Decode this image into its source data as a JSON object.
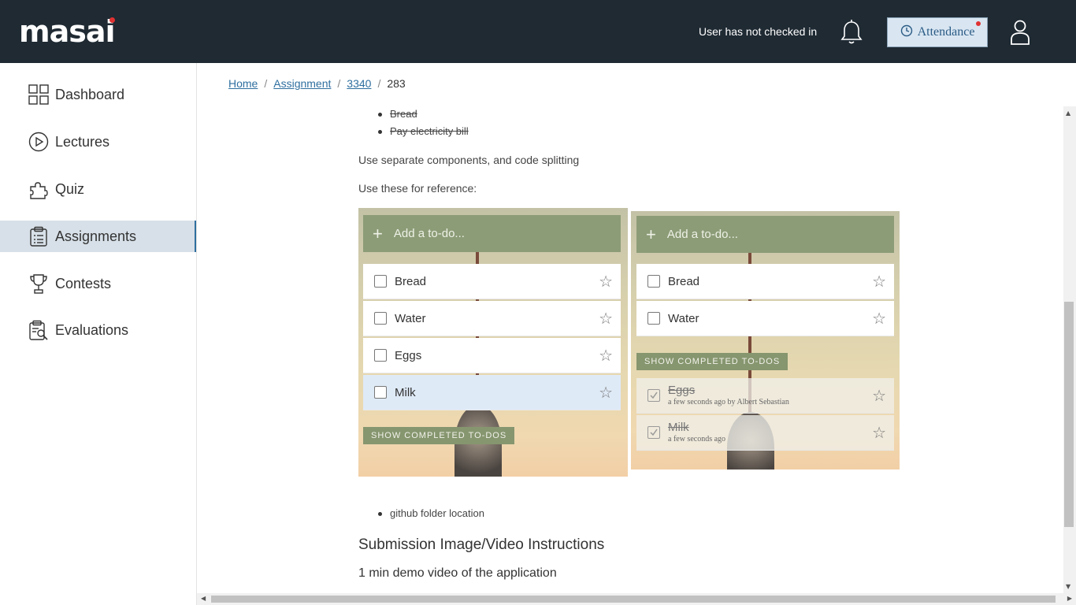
{
  "brand": {
    "name": "masai"
  },
  "header": {
    "checkin_status": "User has not checked in",
    "attendance_label": "Attendance"
  },
  "sidebar": {
    "items": [
      {
        "label": "Dashboard",
        "icon": "dashboard-icon",
        "active": false
      },
      {
        "label": "Lectures",
        "icon": "play-circle-icon",
        "active": false
      },
      {
        "label": "Quiz",
        "icon": "puzzle-icon",
        "active": false
      },
      {
        "label": "Assignments",
        "icon": "clipboard-icon",
        "active": true
      },
      {
        "label": "Contests",
        "icon": "trophy-icon",
        "active": false
      },
      {
        "label": "Evaluations",
        "icon": "evaluation-icon",
        "active": false
      }
    ]
  },
  "breadcrumb": {
    "items": [
      "Home",
      "Assignment",
      "3340"
    ],
    "current": "283",
    "separator": "/"
  },
  "content": {
    "done_bullets": [
      "Bread",
      "Pay electricity bill"
    ],
    "para1": "Use separate components, and code splitting",
    "para2": "Use these for reference:",
    "bullet_github": "github folder location",
    "heading": "Submission Image/Video Instructions",
    "subheading": "1 min demo video of the application"
  },
  "ref_left": {
    "placeholder": "Add a to-do...",
    "todos": [
      "Bread",
      "Water",
      "Eggs",
      "Milk"
    ],
    "show_completed": "SHOW COMPLETED TO-DOS"
  },
  "ref_right": {
    "placeholder": "Add a to-do...",
    "todos": [
      "Bread",
      "Water"
    ],
    "show_completed": "SHOW COMPLETED TO-DOS",
    "completed": [
      {
        "label": "Eggs",
        "meta": "a few seconds ago by Albert Sebastian"
      },
      {
        "label": "Milk",
        "meta": "a few seconds ago"
      }
    ]
  },
  "colors": {
    "topbar": "#1f2a33",
    "accent": "#2f6f9f",
    "sidebar_active": "#d7e0e8",
    "todo_header": "#8c9c77"
  }
}
